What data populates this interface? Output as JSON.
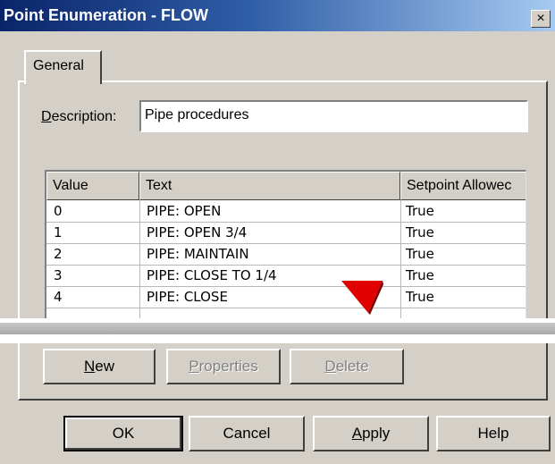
{
  "window": {
    "title": "Point Enumeration - FLOW",
    "close_glyph": "×"
  },
  "tabs": [
    {
      "label": "General"
    }
  ],
  "description": {
    "label_mnemonic": "D",
    "label_rest": "escription:",
    "value": "Pipe procedures"
  },
  "table": {
    "columns": [
      "Value",
      "Text",
      "Setpoint Allowec"
    ],
    "rows": [
      {
        "value": "0",
        "text": "PIPE: OPEN",
        "setpoint": "True"
      },
      {
        "value": "1",
        "text": "PIPE: OPEN 3/4",
        "setpoint": "True"
      },
      {
        "value": "2",
        "text": "PIPE: MAINTAIN",
        "setpoint": "True"
      },
      {
        "value": "3",
        "text": "PIPE: CLOSE TO 1/4",
        "setpoint": "True"
      },
      {
        "value": "4",
        "text": "PIPE: CLOSE",
        "setpoint": "True"
      }
    ]
  },
  "list_buttons": {
    "new_mnemonic": "N",
    "new_rest": "ew",
    "properties_mnemonic": "P",
    "properties_rest": "roperties",
    "delete_mnemonic": "D",
    "delete_rest": "elete"
  },
  "dialog_buttons": {
    "ok": "OK",
    "cancel": "Cancel",
    "apply_mnemonic": "A",
    "apply_rest": "pply",
    "help": "Help"
  },
  "colors": {
    "titlebar_start": "#0a246a",
    "titlebar_end": "#a6caf0",
    "dialog_face": "#d4d0c8",
    "cursor_arrow": "#e00000"
  },
  "icons": {
    "cursor": "red-arrow-cursor-icon"
  }
}
